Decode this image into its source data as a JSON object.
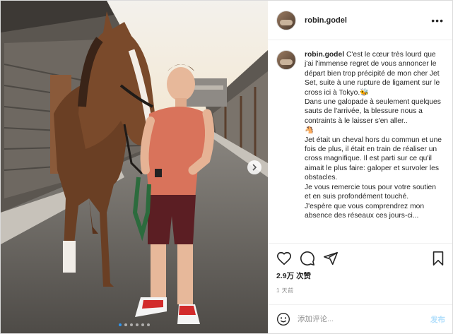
{
  "post": {
    "username": "robin.godel",
    "more_icon": "more-horizontal-icon",
    "caption_lines": [
      "C'est le cœur très lourd que j'ai l'immense regret de vous annoncer le départ bien trop précipité de mon cher Jet Set, suite à une rupture de ligament sur le cross ici à Tokyo.🐝",
      "Dans une galopade à seulement quelques sauts de l'arrivée, la blessure nous a contraints à le laisser s'en aller..",
      "🐴",
      "Jet était un cheval hors du commun et une fois de plus, il était en train de réaliser un cross magnifique. Il est parti sur ce qu'il aimait le plus faire: galoper et survoler les obstacles.",
      "Je vous remercie tous pour votre soutien et en suis profondément touché.",
      "J'espère que vous comprendrez mon absence des réseaux ces jours-ci..."
    ],
    "likes": "2.9万 次赞",
    "time": "1 天前",
    "comment_placeholder": "添加评论...",
    "post_button": "发布",
    "icons": [
      "heart-icon",
      "comment-icon",
      "share-icon",
      "bookmark-icon",
      "emoji-icon",
      "chevron-right-icon"
    ],
    "carousel": {
      "count": 6,
      "active": 0
    },
    "colors": {
      "accent": "#0095f6",
      "post_button_disabled": "#b2dffc",
      "muted": "#8e8e8e"
    }
  }
}
